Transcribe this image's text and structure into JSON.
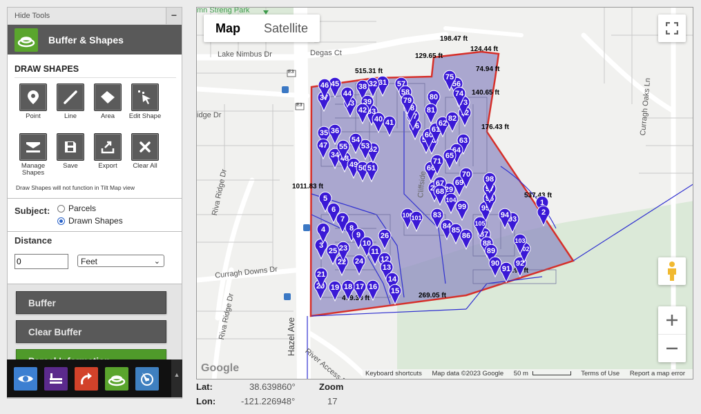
{
  "tools": {
    "hide_label": "Hide Tools",
    "collapse_glyph": "−",
    "panel_title": "Buffer & Shapes",
    "draw_title": "DRAW SHAPES",
    "buttons": [
      {
        "label": "Point",
        "icon": "map-marker-icon"
      },
      {
        "label": "Line",
        "icon": "line-icon"
      },
      {
        "label": "Area",
        "icon": "polygon-area-icon"
      },
      {
        "label": "Edit Shape",
        "icon": "edit-shape-cursor-icon"
      },
      {
        "label": "Manage Shapes",
        "icon": "manage-shapes-icon"
      },
      {
        "label": "Save",
        "icon": "save-floppy-icon"
      },
      {
        "label": "Export",
        "icon": "export-icon"
      },
      {
        "label": "Clear All",
        "icon": "clear-all-x-icon"
      }
    ],
    "note": "Draw Shapes will not function in Tilt Map view",
    "subject": {
      "label": "Subject:",
      "options": [
        {
          "label": "Parcels",
          "checked": false
        },
        {
          "label": "Drawn Shapes",
          "checked": true
        }
      ]
    },
    "distance": {
      "label": "Distance",
      "value": "0",
      "unit": "Feet"
    },
    "action_buttons": [
      "Buffer",
      "Clear Buffer",
      "Parcel Information"
    ]
  },
  "toolbar": {
    "icons": [
      {
        "name": "eye-icon",
        "color": "#3c7fd1"
      },
      {
        "name": "layers-list-icon",
        "color": "#5b2a8c"
      },
      {
        "name": "redo-arrow-icon",
        "color": "#d2422a"
      },
      {
        "name": "buffer-rings-icon",
        "color": "#5aa52d"
      },
      {
        "name": "compass-icon",
        "color": "#3f80c0"
      }
    ]
  },
  "map": {
    "type_controls": {
      "map": "Map",
      "satellite": "Satellite",
      "selected": "Map"
    },
    "streets": [
      "Lake Nimbus Dr",
      "Degas Ct",
      "idge Dr",
      "Riva Ridge Dr",
      "Curragh Downs Dr",
      "Riva Ridge Dr",
      "Hazel Ave",
      "River Access Rd",
      "Curragh Oaks Ln",
      "Cliffside",
      "mn Streng Park",
      "E3",
      "E3"
    ],
    "measurements": [
      "198.47 ft",
      "124.44 ft",
      "129.65 ft",
      "515.31 ft",
      "74.94 ft",
      "140.65 ft",
      "176.43 ft",
      "1011.83 ft",
      "537.43 ft",
      "479.38 ft",
      "269.05 ft",
      "213.94 ft"
    ],
    "attribution": {
      "google": "Google",
      "shortcuts": "Keyboard shortcuts",
      "data": "Map data ©2023 Google",
      "scale": "50 m",
      "terms": "Terms of Use",
      "report": "Report a map error"
    },
    "pins": [
      "1",
      "2",
      "3",
      "4",
      "5",
      "6",
      "7",
      "8",
      "9",
      "10",
      "11",
      "12",
      "13",
      "14",
      "15",
      "16",
      "17",
      "18",
      "19",
      "20",
      "21",
      "22",
      "23",
      "24",
      "25",
      "26",
      "27",
      "28",
      "29",
      "30",
      "31",
      "32",
      "33",
      "34",
      "35",
      "36",
      "37",
      "38",
      "39",
      "40",
      "41",
      "42",
      "43",
      "44",
      "45",
      "46",
      "47",
      "48",
      "49",
      "50",
      "51",
      "52",
      "53",
      "54",
      "55",
      "56",
      "57",
      "58",
      "59",
      "60",
      "61",
      "62",
      "63",
      "64",
      "65",
      "66",
      "67",
      "68",
      "69",
      "70",
      "71",
      "72",
      "73",
      "74",
      "75",
      "76",
      "77",
      "78",
      "79",
      "80",
      "81",
      "82",
      "83",
      "84",
      "85",
      "86",
      "87",
      "88",
      "89",
      "90",
      "91",
      "92",
      "93",
      "94",
      "95",
      "96",
      "97",
      "98",
      "99",
      "100",
      "101",
      "102",
      "103",
      "104",
      "105"
    ],
    "pin_color": "#3a19d6",
    "boundary_color": "#d6302a",
    "fill_color": "#8c88c2"
  },
  "status": {
    "lat_label": "Lat:",
    "lat_value": "38.639860°",
    "lon_label": "Lon:",
    "lon_value": "-121.226948°",
    "zoom_label": "Zoom",
    "zoom_value": "17"
  }
}
